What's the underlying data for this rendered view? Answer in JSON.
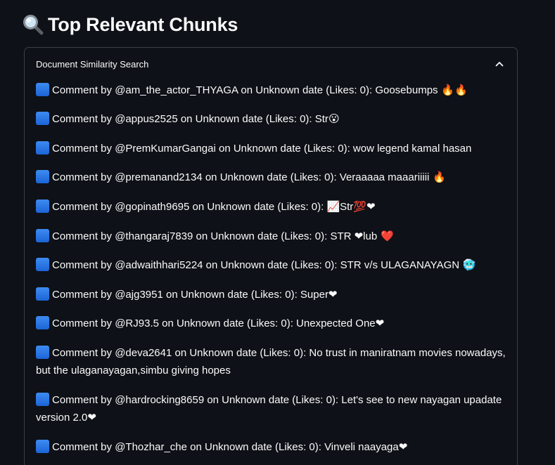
{
  "header": {
    "title_icon": "magnifying-glass-icon",
    "title": "Top Relevant Chunks"
  },
  "expander": {
    "label": "Document Similarity Search",
    "state": "expanded"
  },
  "colors": {
    "background": "#0e1117",
    "border": "#3b3f47",
    "bullet": "#2f7fe6"
  },
  "comments": [
    {
      "text": "Comment by @am_the_actor_THYAGA on Unknown date (Likes: 0): Goosebumps",
      "emoji": " 🔥🔥"
    },
    {
      "text": "Comment by @appus2525 on Unknown date (Likes: 0): Str",
      "emoji": "😮"
    },
    {
      "text": "Comment by @PremKumarGangai on Unknown date (Likes: 0): wow legend kamal hasan",
      "emoji": ""
    },
    {
      "text": "Comment by @premanand2134 on Unknown date (Likes: 0): Veraaaaa maaariiiii",
      "emoji": " 🔥"
    },
    {
      "text": "Comment by @gopinath9695 on Unknown date (Likes: 0): 📈Str💯❤",
      "emoji": ""
    },
    {
      "text": "Comment by @thangaraj7839 on Unknown date (Likes: 0): STR ❤lub",
      "emoji": " ❤️"
    },
    {
      "text": "Comment by @adwaithhari5224 on Unknown date (Likes: 0): STR v/s ULAGANAYAGN",
      "emoji": " 🥶"
    },
    {
      "text": "Comment by @ajg3951 on Unknown date (Likes: 0): Super❤",
      "emoji": ""
    },
    {
      "text": "Comment by @RJ93.5 on Unknown date (Likes: 0): Unexpected One❤",
      "emoji": ""
    },
    {
      "text": "Comment by @deva2641 on Unknown date (Likes: 0): No trust in maniratnam movies nowadays, but the ulaganayagan,simbu giving hopes",
      "emoji": ""
    },
    {
      "text": "Comment by @hardrocking8659 on Unknown date (Likes: 0): Let's see to new nayagan upadate version 2.0❤",
      "emoji": ""
    },
    {
      "text": "Comment by @Thozhar_che on Unknown date (Likes: 0): Vinveli naayaga❤",
      "emoji": ""
    }
  ]
}
